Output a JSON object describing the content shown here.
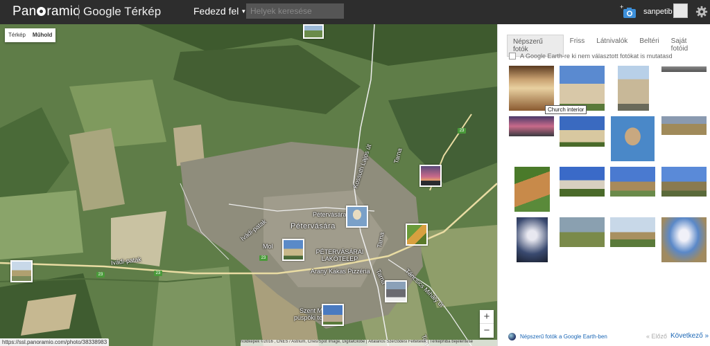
{
  "header": {
    "logo": "Panoramio",
    "subtitle": "Google Térkép",
    "explore_label": "Fedezd fel",
    "search_placeholder": "Helyek keresése",
    "username": "sanpetib"
  },
  "map": {
    "map_types": [
      {
        "label": "Térkép",
        "selected": false
      },
      {
        "label": "Műhold",
        "selected": true
      }
    ],
    "labels": {
      "town": "Pétervására",
      "housing": "PÉTERVÁSÁRAI LAKÓTELEP",
      "poi_petervasara": "Pétervására pc",
      "poi_mol": "Mol",
      "poi_arany": "Arany Kakas Pizzéria",
      "poi_szent": "Szent Má",
      "poi_puspok": "püspöki temp",
      "street_ivadi_patak": "Ivádi-patak",
      "street_ivadi_patak2": "Ivádi-patak",
      "street_kossuth": "Kossuth Lajos út",
      "street_tarna1": "Tarna",
      "street_tarna2": "Tarna",
      "street_tarna3": "Tarna",
      "street_tarna4": "Tarna",
      "street_tancsics": "Táncsics Mihály út",
      "road_23_a": "23",
      "road_23_b": "23",
      "road_23_c": "23",
      "road_23_d": "23"
    },
    "zoom_in": "+",
    "zoom_out": "−",
    "status_url": "https://ssl.panoramio.com/photo/38338983",
    "attribution": "holdképek ©2016 , CNES / Astrium, Cnes/Spot Image, DigitalGlobe | Általános Szerződési Feltételek | Térképhiba bejelentése"
  },
  "panel": {
    "tabs": [
      {
        "label": "Népszerű fotók",
        "active": true
      },
      {
        "label": "Friss",
        "active": false
      },
      {
        "label": "Látnivalók",
        "active": false
      },
      {
        "label": "Beltéri",
        "active": false
      },
      {
        "label": "Saját fotóid",
        "active": false
      }
    ],
    "checkbox_label": "A Google Earth-re ki nem választott fotókat is mutatasd",
    "tooltip": "Church interior",
    "earth_link": "Népszerű fotók a Google Earth-ben",
    "prev_label": "« Előző",
    "next_label": "Következő »"
  },
  "colors": {
    "topbar": "#2d2d2d",
    "link": "#1a66b5",
    "map_base": "#5c7a45"
  },
  "icons": {
    "upload": "camera-plus-icon",
    "settings": "gear-icon",
    "earth": "google-earth-icon"
  }
}
